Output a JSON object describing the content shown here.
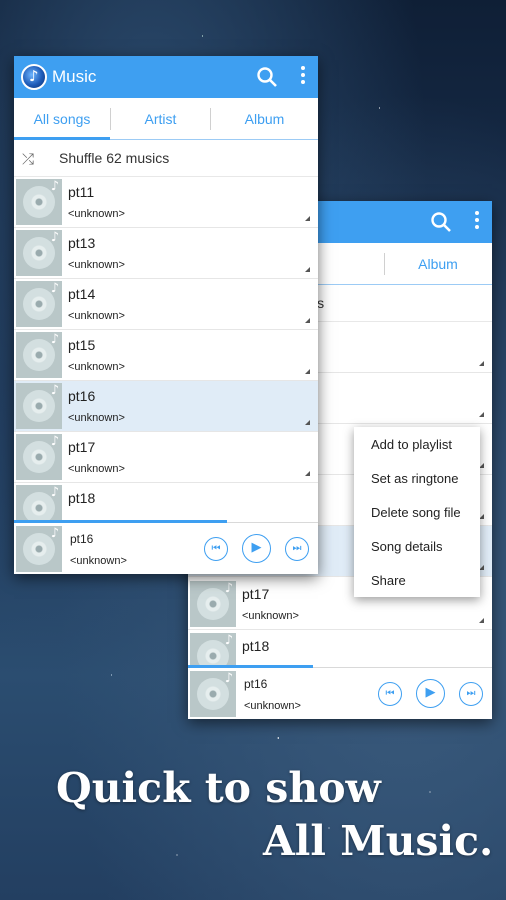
{
  "app": {
    "title": "Music"
  },
  "tabs": [
    "All songs",
    "Artist",
    "Album"
  ],
  "shuffle_label": "Shuffle 62 musics",
  "back_shuffle_fragment": "sics",
  "songs": [
    {
      "name": "pt11",
      "artist": "<unknown>"
    },
    {
      "name": "pt13",
      "artist": "<unknown>"
    },
    {
      "name": "pt14",
      "artist": "<unknown>"
    },
    {
      "name": "pt15",
      "artist": "<unknown>"
    },
    {
      "name": "pt16",
      "artist": "<unknown>"
    },
    {
      "name": "pt17",
      "artist": "<unknown>"
    },
    {
      "name": "pt18",
      "artist": "<unknown>"
    }
  ],
  "now_playing": {
    "name": "pt16",
    "artist": "<unknown>",
    "progress_front": 0.7,
    "progress_back": 0.41
  },
  "context_menu": [
    "Add to playlist",
    "Set as ringtone",
    "Delete song file",
    "Song details",
    "Share"
  ],
  "caption": {
    "line1": "Quick to show",
    "line2": "All Music."
  },
  "icons": {
    "search": "search-icon",
    "more": "more-vertical-icon",
    "shuffle": "shuffle-icon",
    "prev": "previous-icon",
    "play": "play-icon",
    "next": "next-icon"
  },
  "colors": {
    "accent": "#3e9ff1",
    "selected_row": "#e0ecf7"
  }
}
